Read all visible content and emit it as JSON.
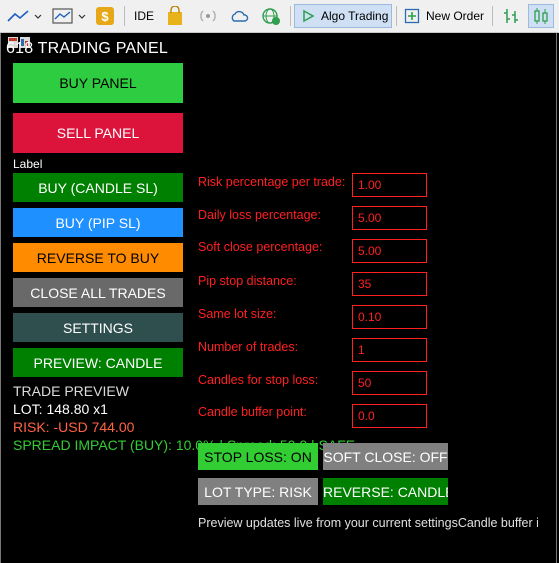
{
  "toolbar": {
    "ide_label": "IDE",
    "algo_label": "Algo Trading",
    "new_order_label": "New Order"
  },
  "panel": {
    "title": "618 TRADING PANEL",
    "buy_panel": "BUY PANEL",
    "sell_panel": "SELL PANEL",
    "label_text": "Label",
    "buy_candle": "BUY (CANDLE SL)",
    "buy_pip": "BUY (PIP SL)",
    "reverse": "REVERSE TO BUY",
    "close_all": "CLOSE ALL TRADES",
    "settings": "SETTINGS",
    "preview_candle": "PREVIEW: CANDLE"
  },
  "preview": {
    "heading": "TRADE PREVIEW",
    "lot": "LOT: 148.80 x1",
    "risk": "RISK: -USD 744.00",
    "spread": "SPREAD IMPACT (BUY): 10.0% | Spread: 50.0 | SAFE"
  },
  "fields": [
    {
      "label": "Risk percentage per trade:",
      "value": "1.00"
    },
    {
      "label": "Daily loss percentage:",
      "value": "5.00"
    },
    {
      "label": "Soft close percentage:",
      "value": "5.00"
    },
    {
      "label": "Pip stop distance:",
      "value": "35"
    },
    {
      "label": "Same lot size:",
      "value": "0.10"
    },
    {
      "label": "Number of trades:",
      "value": "1"
    },
    {
      "label": "Candles for stop loss:",
      "value": "50"
    },
    {
      "label": "Candle buffer point:",
      "value": "0.0"
    }
  ],
  "toggles": {
    "stop_loss": "STOP LOSS: ON",
    "soft_close": "SOFT CLOSE: OFF",
    "lot_type": "LOT TYPE: RISK",
    "reverse": "REVERSE: CANDLES"
  },
  "footer": "Preview updates live from your current settingsCandle buffer i",
  "colors": {
    "buy_green": "#2ecc40",
    "sell_red": "#dc143c",
    "candle_green": "#008000",
    "pip_blue": "#1e90ff",
    "reverse_orange": "#ff8c00",
    "close_gray": "#696969",
    "settings_slate": "#2f4f4f",
    "field_red": "#ff2020",
    "toggle_green": "#32cd32",
    "toggle_gray": "#808080"
  }
}
